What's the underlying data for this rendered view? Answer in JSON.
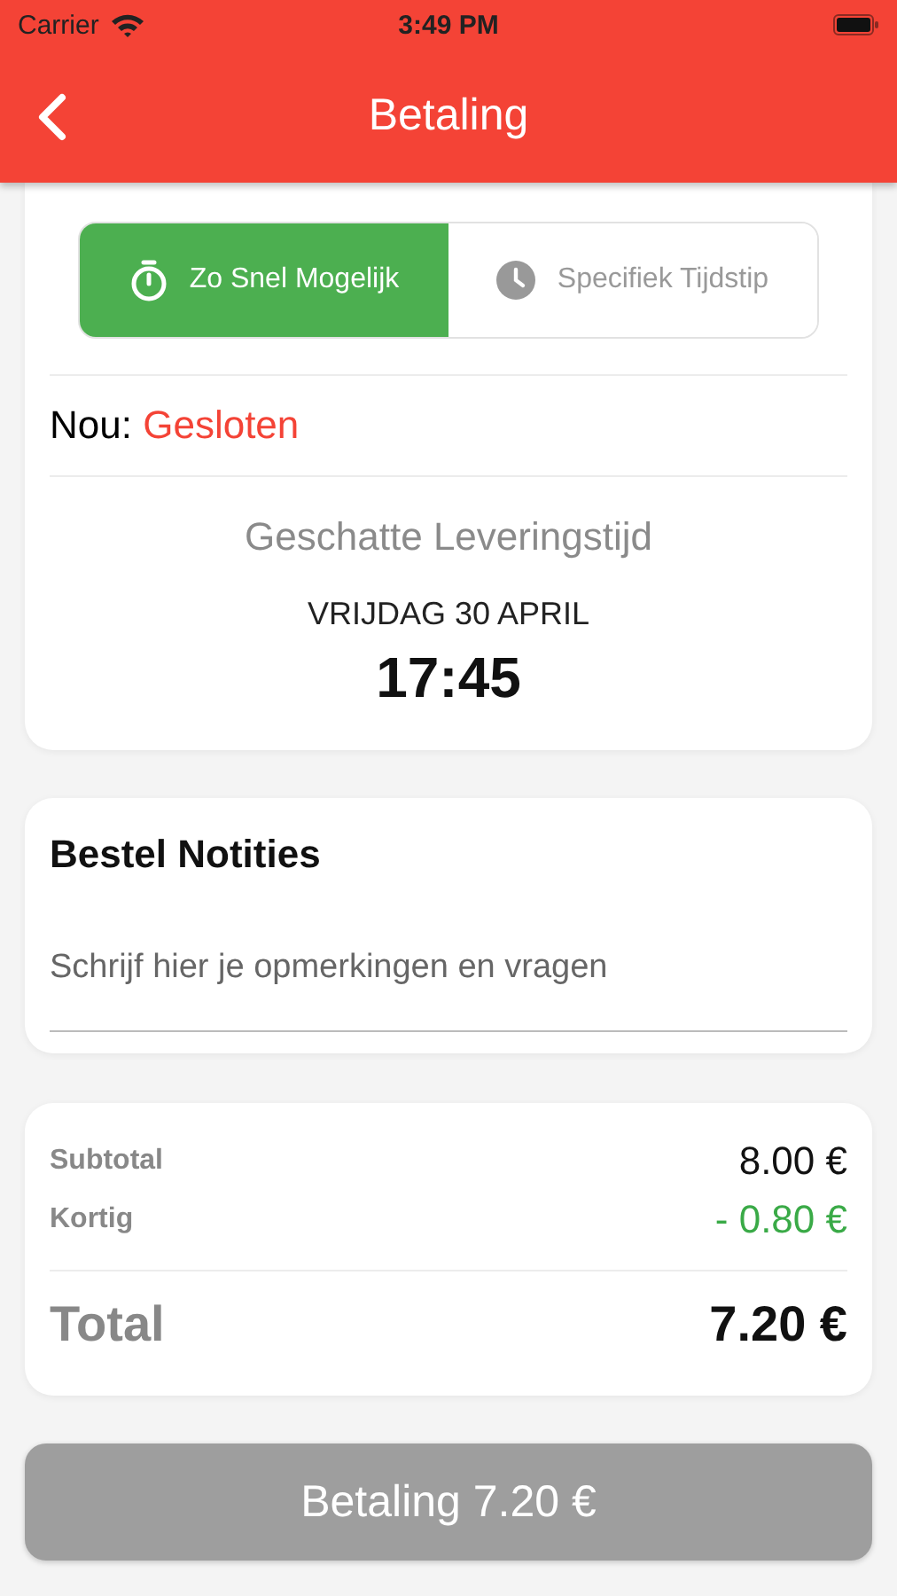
{
  "status_bar": {
    "carrier": "Carrier",
    "time": "3:49 PM"
  },
  "nav_bar": {
    "title": "Betaling"
  },
  "delivery": {
    "options": [
      {
        "label": "Zo Snel Mogelijk",
        "selected": true
      },
      {
        "label": "Specifiek Tijdstip",
        "selected": false
      }
    ],
    "status_label": "Nou:",
    "status_value": "Gesloten",
    "estimate_title": "Geschatte Leveringstijd",
    "estimate_date": "VRIJDAG 30 APRIL",
    "estimate_time": "17:45"
  },
  "notes": {
    "title": "Bestel Notities",
    "placeholder": "Schrijf hier je opmerkingen en vragen"
  },
  "summary": {
    "rows": [
      {
        "label": "Subtotal",
        "value": "8.00 €",
        "kind": "normal"
      },
      {
        "label": "Kortig",
        "value": "- 0.80 €",
        "kind": "discount"
      }
    ],
    "total_label": "Total",
    "total_value": "7.20 €"
  },
  "pay_button": {
    "label": "Betaling 7.20 €",
    "disabled": true
  }
}
